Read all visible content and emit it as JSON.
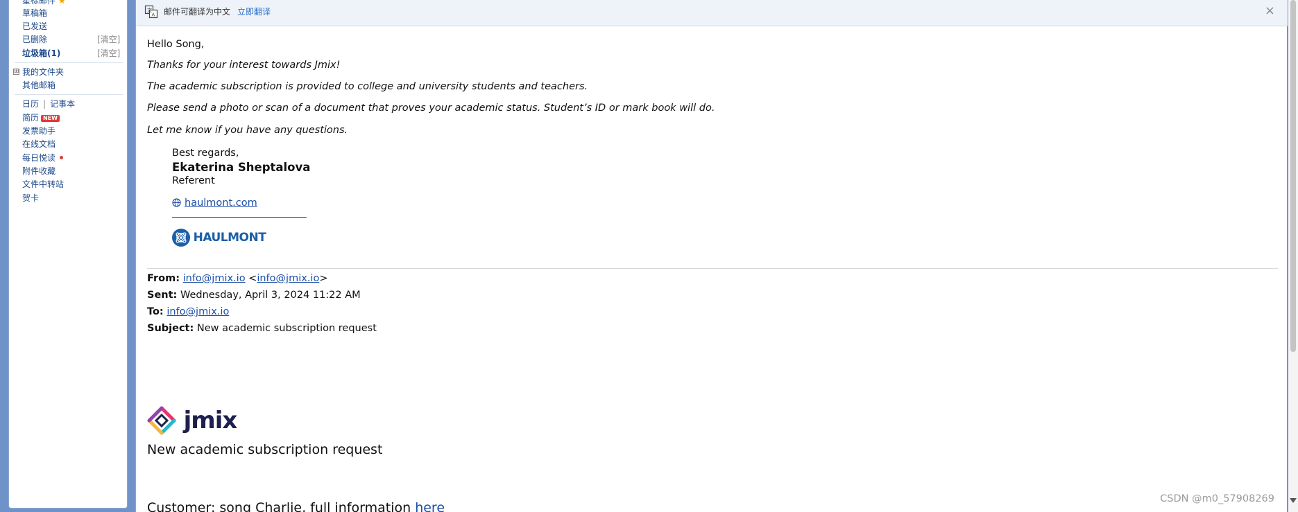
{
  "sidebar": {
    "starred": {
      "label": "星标邮件"
    },
    "drafts": {
      "label": "草稿箱"
    },
    "sent": {
      "label": "已发送"
    },
    "deleted": {
      "label": "已删除",
      "action": "[清空]"
    },
    "spam": {
      "label": "垃圾箱(1)",
      "action": "[清空]"
    },
    "my_folders": {
      "label": "我的文件夹",
      "expander": "⊞"
    },
    "other_mailboxes": {
      "label": "其他邮箱"
    },
    "calendar": {
      "label": "日历"
    },
    "separator": "|",
    "notebook": {
      "label": "记事本"
    },
    "resume": {
      "label": "简历",
      "badge": "NEW"
    },
    "invoice_helper": {
      "label": "发票助手"
    },
    "online_docs": {
      "label": "在线文档"
    },
    "daily_reading": {
      "label": "每日悦读"
    },
    "attachments": {
      "label": "附件收藏"
    },
    "file_transfer": {
      "label": "文件中转站"
    },
    "greeting_cards": {
      "label": "贺卡"
    }
  },
  "translate_bar": {
    "text": "邮件可翻译为中文",
    "action": "立即翻译",
    "close": "×"
  },
  "email": {
    "greeting": "Hello Song,",
    "paragraphs": [
      "Thanks for your interest towards Jmix!",
      "The academic subscription is provided to college and university students and teachers.",
      "Please send a photo or scan of a document that proves your academic status. Student’s ID or mark book will do.",
      "Let me know if you have any questions."
    ],
    "signature": {
      "closing": "Best regards,",
      "name": "Ekaterina Sheptalova",
      "title": "Referent",
      "website": "haulmont.com",
      "logo_text": "HAULMONT"
    },
    "forwarded": {
      "from_label": "From:",
      "from_value": "info@jmix.io",
      "from_angle": "info@jmix.io",
      "sent_label": "Sent:",
      "sent_value": "Wednesday, April 3, 2024 11:22 AM",
      "to_label": "To:",
      "to_value": "info@jmix.io",
      "subject_label": "Subject:",
      "subject_value": "New academic subscription request"
    },
    "jmix": {
      "logo_text": "jmix",
      "heading": "New academic subscription request",
      "customer_prefix": "Customer: song Charlie, full information ",
      "customer_link": "here"
    }
  },
  "watermark": "CSDN @m0_57908269",
  "colors": {
    "background": "#6f93c9",
    "link": "#1c4fa8",
    "sidebar_text": "#1e4a8a",
    "badge": "#e2393b",
    "haulmont_blue": "#1b5fa8",
    "jmix_navy": "#1d1f4e"
  }
}
